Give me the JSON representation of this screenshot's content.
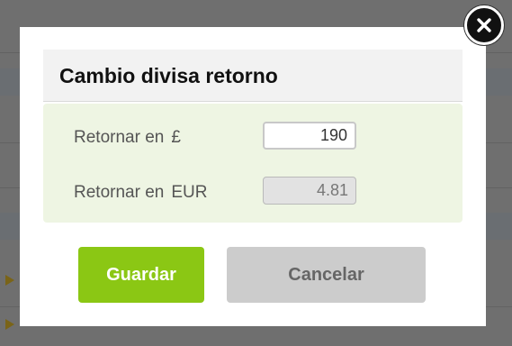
{
  "dialog": {
    "title": "Cambio divisa retorno",
    "fields": [
      {
        "label": "Retornar en",
        "currency": "£",
        "value": "190"
      },
      {
        "label": "Retornar en",
        "currency": "EUR",
        "value": "4.81"
      }
    ],
    "buttons": {
      "save_label": "Guardar",
      "cancel_label": "Cancelar"
    },
    "close_icon": "close-icon"
  },
  "colors": {
    "save_button": "#8bc714",
    "cancel_button": "#cccccc",
    "form_panel": "#eef5e3",
    "overlay": "#6f6f6f"
  }
}
